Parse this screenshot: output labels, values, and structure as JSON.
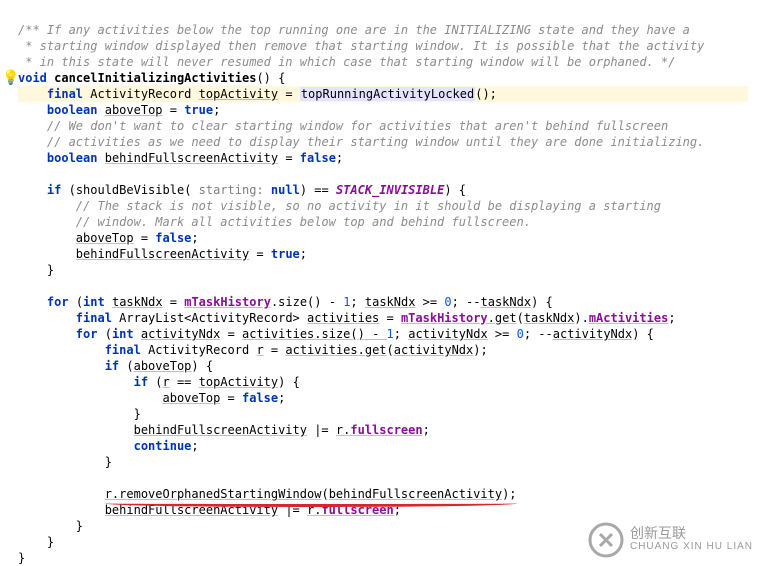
{
  "code": {
    "l1": "/** If any activities below the top running one are in the INITIALIZING state and they have a",
    "l2": " * starting window displayed then remove that starting window. It is possible that the activity",
    "l3": " * in this state will never resumed in which case that starting window will be orphaned. */",
    "l4_kw_void": "void",
    "l4_method": "cancelInitializingActivities",
    "l4_tail": "() {",
    "l5_kw_final": "final",
    "l5_type": "ActivityRecord",
    "l5_var": "topActivity",
    "l5_eq": " = ",
    "l5_call": "topRunningActivityLocked",
    "l5_tail": "();",
    "l6_kw_boolean": "boolean",
    "l6_var": "aboveTop",
    "l6_eq_true": " = ",
    "l6_true": "true",
    "l6_semi": ";",
    "l7": "// We don't want to clear starting window for activities that aren't behind fullscreen",
    "l8": "// activities as we need to display their starting window until they are done initializing.",
    "l9_kw_boolean": "boolean",
    "l9_var": "behindFullscreenActivity",
    "l9_eq": " = ",
    "l9_false": "false",
    "l9_semi": ";",
    "l10_if": "if",
    "l10_open": " (",
    "l10_call": "shouldBeVisible",
    "l10_paren_open": "( ",
    "l10_param_name": "starting:",
    "l10_null": "null",
    "l10_mid": ") == ",
    "l10_const": "STACK_INVISIBLE",
    "l10_close": ") {",
    "l11": "// The stack is not visible, so no activity in it should be displaying a starting",
    "l12": "// window. Mark all activities below top and behind fullscreen.",
    "l13_var": "aboveTop",
    "l13_eq": " = ",
    "l13_false": "false",
    "l13_semi": ";",
    "l14_var": "behindFullscreenActivity",
    "l14_eq": " = ",
    "l14_true": "true",
    "l14_semi": ";",
    "l15_close": "}",
    "l16_for": "for",
    "l16_open": " (",
    "l16_int": "int",
    "l16_var": "taskNdx",
    "l16_eq": " = ",
    "l16_field": "mTaskHistory",
    "l16_call": ".size() - ",
    "l16_one": "1",
    "l16_semi1": "; ",
    "l16_var2": "taskNdx",
    "l16_ge": " >= ",
    "l16_zero": "0",
    "l16_semi2": "; --",
    "l16_var3": "taskNdx",
    "l16_close": ") {",
    "l17_final": "final",
    "l17_type": "ArrayList<ActivityRecord>",
    "l17_var": "activities",
    "l17_eq": " = ",
    "l17_field": "mTaskHistory",
    "l17_get": ".get",
    "l17_arg_open": "(",
    "l17_arg": "taskNdx",
    "l17_arg_close": ").",
    "l17_mact": "mActivities",
    "l17_semi": ";",
    "l18_for": "for",
    "l18_open": " (",
    "l18_int": "int",
    "l18_var": "activityNdx",
    "l18_eq": " = ",
    "l18_call": "activities.size() - ",
    "l18_one": "1",
    "l18_semi1": "; ",
    "l18_var2": "activityNdx",
    "l18_ge": " >= ",
    "l18_zero": "0",
    "l18_semi2": "; --",
    "l18_var3": "activityNdx",
    "l18_close": ") {",
    "l19_final": "final",
    "l19_type": "ActivityRecord",
    "l19_var": "r",
    "l19_eq": " = ",
    "l19_call": "activities.get",
    "l19_arg_open": "(",
    "l19_arg": "activityNdx",
    "l19_tail": ");",
    "l20_if": "if",
    "l20_open": " (",
    "l20_var": "aboveTop",
    "l20_close": ") {",
    "l21_if": "if",
    "l21_open": " (",
    "l21_r": "r",
    "l21_eq": " == ",
    "l21_top": "topActivity",
    "l21_close": ") {",
    "l22_var": "aboveTop",
    "l22_eq": " = ",
    "l22_false": "false",
    "l22_semi": ";",
    "l23_close": "}",
    "l24_var": "behindFullscreenActivity",
    "l24_op": " |= ",
    "l24_r": "r.",
    "l24_field": "fullscreen",
    "l24_semi": ";",
    "l25_kw": "continue",
    "l25_semi": ";",
    "l26_close": "}",
    "l27_call": "r.removeOrphanedStartingWindow",
    "l27_open": "(",
    "l27_arg": "behindFullscreenActivity",
    "l27_close": ");",
    "l28_var": "behindFullscreenActivity",
    "l28_op": " |= ",
    "l28_r": "r.",
    "l28_field": "fullscreen",
    "l28_semi": ";",
    "l29_close": "}",
    "l30_close": "}",
    "l31_close": "}"
  },
  "logo": {
    "top": "创新互联",
    "bottom": "CHUANG XIN HU LIAN"
  }
}
